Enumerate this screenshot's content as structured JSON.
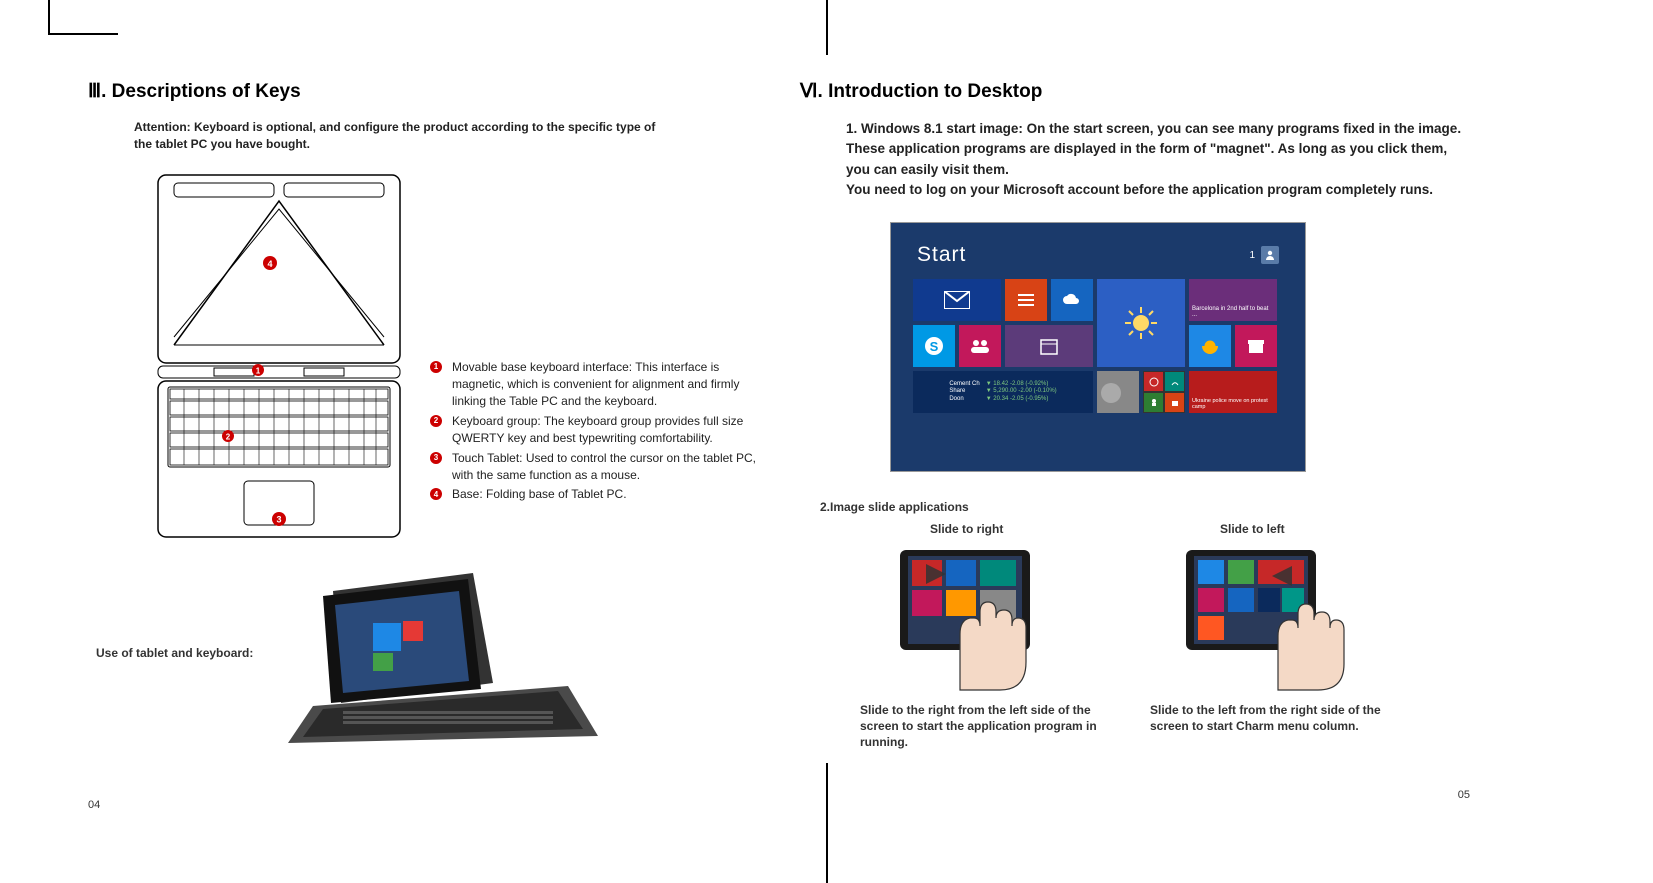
{
  "left": {
    "heading": "Ⅲ. Descriptions of Keys",
    "attention": "Attention: Keyboard is optional, and configure the product according to the specific type of the tablet PC you have bought.",
    "legend": {
      "1": "Movable base keyboard interface: This interface is magnetic, which is convenient for alignment and firmly linking the Table PC and the keyboard.",
      "2": "Keyboard group: The keyboard group provides full size QWERTY key and best typewriting comfortability.",
      "3": "Touch Tablet: Used to control the cursor on the tablet PC, with the same function as a mouse.",
      "4": "Base: Folding base of Tablet PC."
    },
    "usage_label": "Use of tablet and keyboard:",
    "page_num": "04"
  },
  "right": {
    "heading": "Ⅵ. Introduction to Desktop",
    "intro1": "1. Windows 8.1 start image: On the start screen, you can see many programs fixed in the image. These application programs are displayed in the form of \"magnet\". As long as you click them, you can easily visit them.",
    "intro2": "You need to log on your Microsoft account before the application program completely runs.",
    "start_title": "Start",
    "user_num": "1",
    "sub2": "2.Image slide applications",
    "slide_right_title": "Slide to right",
    "slide_left_title": "Slide to left",
    "slide_right_caption": "Slide to the right from the left side of the screen to start the application program in running.",
    "slide_left_caption": "Slide to the left from the right side of the screen to start Charm menu column.",
    "page_num": "05"
  }
}
